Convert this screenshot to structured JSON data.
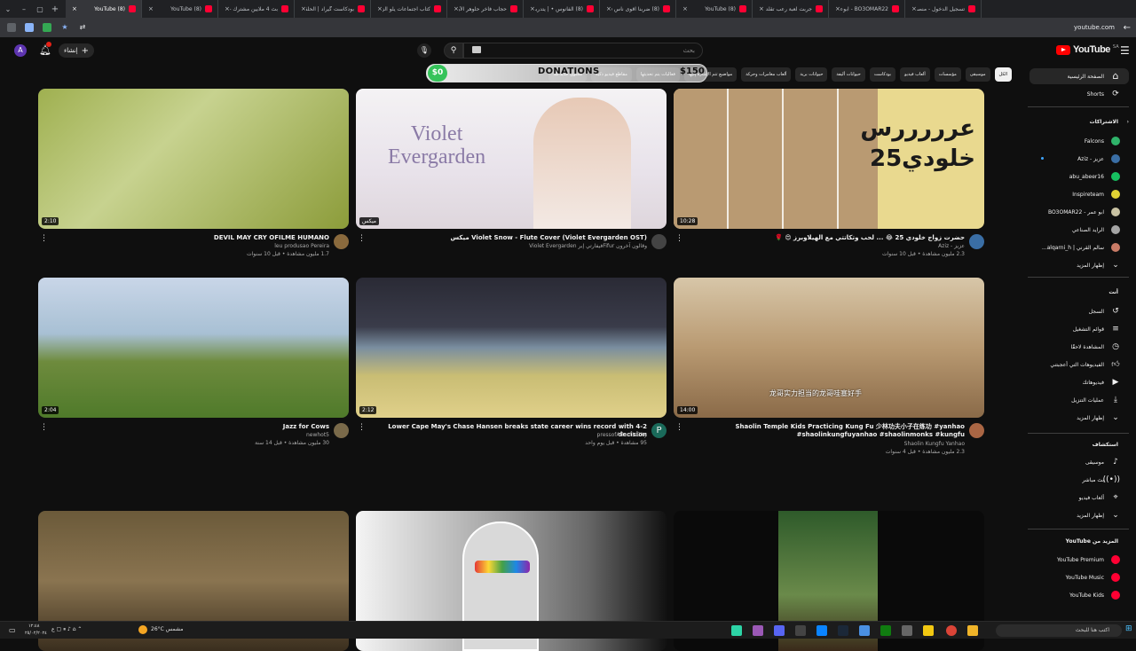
{
  "browser": {
    "tabs": [
      {
        "title": "(8) YouTube",
        "active": true
      },
      {
        "title": "(8) YouTube"
      },
      {
        "title": "بث 4 ملايين مشترك - ء"
      },
      {
        "title": "بودكاست گيراد | الحلقة"
      },
      {
        "title": "كتاب اجتماعات يلو الزيا..."
      },
      {
        "title": "حجاب فاخر حلوهر الأن؟ |"
      },
      {
        "title": "(8) الفانوس • | يتدربنا"
      },
      {
        "title": "(8) ضربنا اقوى ناس في"
      },
      {
        "title": "(8) YouTube"
      },
      {
        "title": "جربت لعبة رعب تقلد ال..."
      },
      {
        "title": "BO3OMAR22 - ابوعمر"
      },
      {
        "title": "تسجيل الدخول - منصة"
      }
    ],
    "new_tab": "+",
    "url": "youtube.com"
  },
  "masthead": {
    "avatar_letter": "A",
    "create_label": "إنشاء",
    "search_placeholder": "بحث",
    "logo_text": "YouTube",
    "region": "SA"
  },
  "chips": [
    "الكل",
    "موسيقى",
    "مؤسسات",
    "ألعاب فيديو",
    "بودكاست",
    "حيوانات أليفة",
    "حيوانات برية",
    "ألعاب مغامرات وحركة",
    "مواضيع تتم الإشارة إليها",
    "فعاليات يتم تحديثها",
    "مقاطع فيديو ذكية",
    "محتوى جديد لك"
  ],
  "donation_widget": {
    "left_amount": "$0",
    "label": "DONATIONS",
    "right_amount": "$150"
  },
  "sidebar": {
    "home": "الصفحة الرئيسية",
    "shorts": "Shorts",
    "subs_header": "الاشتراكات",
    "subscriptions": [
      {
        "name": "Falcons",
        "color": "#2fb36a"
      },
      {
        "name": "عزيز - Aziz",
        "color": "#3a6ea5",
        "new": true
      },
      {
        "name": "abu_abeer16",
        "color": "#16c060"
      },
      {
        "name": "Inspireteam",
        "color": "#e0d234"
      },
      {
        "name": "ابو عمر - BO3OMAR22",
        "color": "#c9c3a3"
      },
      {
        "name": "الرايد الصناعي",
        "color": "#a5a5a5"
      },
      {
        "name": "سالم القرني | alqarni_h...",
        "color": "#c97b66"
      }
    ],
    "show_more": "إظهار المزيد",
    "you_header": "أنت",
    "you_items": [
      {
        "label": "السجل",
        "icon": "history-icon"
      },
      {
        "label": "قوائم التشغيل",
        "icon": "playlist-icon"
      },
      {
        "label": "المشاهدة لاحقًا",
        "icon": "clock-icon"
      },
      {
        "label": "الفيديوهات التي أعجبتني",
        "icon": "like-icon"
      },
      {
        "label": "فيديوهاتك",
        "icon": "video-icon"
      },
      {
        "label": "عمليات التنزيل",
        "icon": "download-icon"
      },
      {
        "label": "إظهار المزيد",
        "icon": "chevron-down-icon"
      }
    ],
    "explore_header": "استكشاف",
    "explore_items": [
      {
        "label": "موسيقى",
        "icon": "music-icon"
      },
      {
        "label": "بث مباشر",
        "icon": "live-icon"
      },
      {
        "label": "ألعاب فيديو",
        "icon": "gaming-icon"
      },
      {
        "label": "إظهار المزيد",
        "icon": "chevron-down-icon"
      }
    ],
    "more_header": "المزيد من YouTube",
    "more_items": [
      {
        "label": "YouTube Premium"
      },
      {
        "label": "YouTube Music"
      },
      {
        "label": "YouTube Kids"
      }
    ]
  },
  "videos": [
    {
      "title": "DEVIL MAY CRY OFILME HUMANO",
      "channel": "leu produsao Pereira",
      "stats": "1.7 مليون مشاهدة • قبل 10 سنوات",
      "duration": "2:10",
      "avatar_color": "#8a6a3d"
    },
    {
      "title": "Violet Snow - Flute Cover (Violet Evergarden OST) ميكس",
      "channel": "وقالون آخرون Fifurفيفارتي إبر Violet Evergarden",
      "stats": "",
      "duration": "ميكس",
      "avatar_color": "#444"
    },
    {
      "title": "حضرت زواج خلودي 25 😂 ... لحب وتكاتتي مع الهيلاوبرز 😍 🌹",
      "channel": "عزيز - Aziz",
      "stats": "2.3 مليون مشاهدة • قبل 10 سنوات",
      "duration": "10:28",
      "avatar_color": "#3a6ea5"
    },
    {
      "title": "Jazz for Cows",
      "channel": "newhot5",
      "stats": "30 مليون مشاهدة • قبل 14 سنة",
      "duration": "2:04",
      "avatar_color": "#7a6a4a"
    },
    {
      "title": "Lower Cape May's Chase Hansen breaks state career wins record with 4-2 decision",
      "channel": "pressofAtlanticCity",
      "stats": "95 مشاهدة • قبل يوم واحد",
      "duration": "2:12",
      "avatar_color": "#1a6a5a",
      "avatar_letter": "P"
    },
    {
      "title": "Shaolin Temple Kids Practicing Kung Fu 少林功夫小子在练功 #yanhao #shaolinkungfuyanhao #shaolinmonks #kungfu",
      "channel": "Shaolin Kungfu Yanhao",
      "stats": "2.3 مليون مشاهدة • قبل 4 سنوات",
      "duration": "14:00",
      "avatar_color": "#aa6644"
    },
    {
      "title": "",
      "channel": "",
      "stats": "",
      "duration": "",
      "avatar_color": "#555"
    },
    {
      "title": "",
      "channel": "",
      "stats": "",
      "duration": "",
      "avatar_color": "#555"
    },
    {
      "title": "",
      "channel": "",
      "stats": "",
      "duration": "",
      "avatar_color": "#555"
    }
  ],
  "thumb_texts": {
    "violet_line1": "Violet",
    "violet_line2": "Evergarden",
    "aziz_line1": "عرررررس",
    "aziz_line2": "خلودي25",
    "shaolin_sub": "龙哥实力担当的龙哥哇塞好手"
  },
  "taskbar": {
    "weather": "26°C مشمس",
    "time": "١٢:٤٨",
    "date": "٢٥/٠٢/٢٠٢٤",
    "search_placeholder": "اكتب هنا للبحث"
  }
}
